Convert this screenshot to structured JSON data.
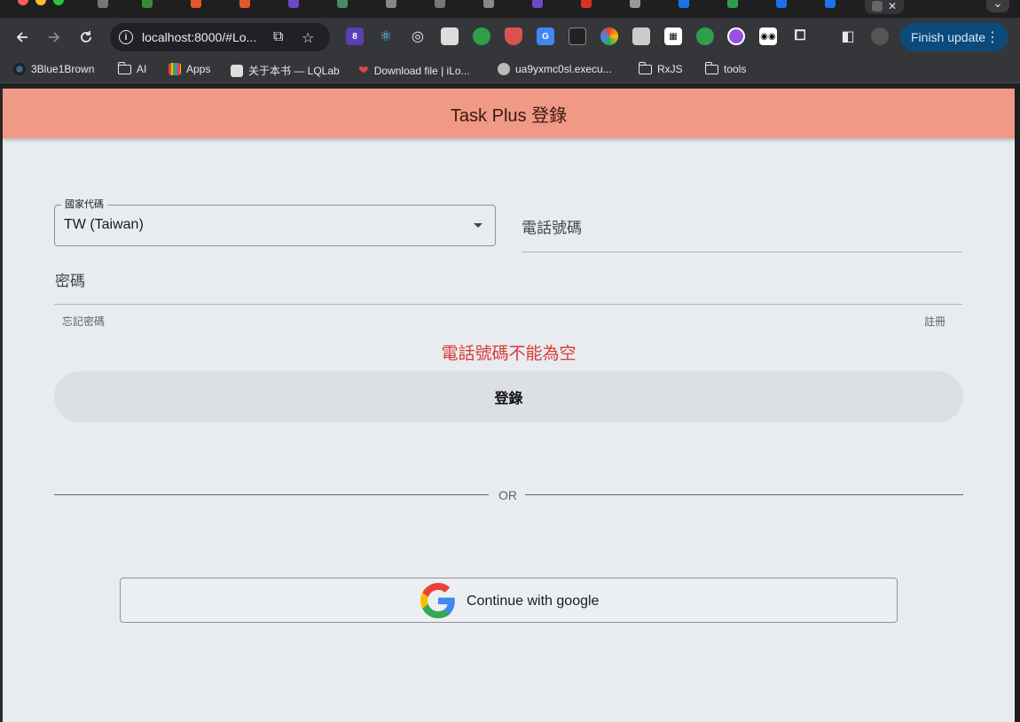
{
  "browser": {
    "address": "localhost:8000/#Lo...",
    "finish_update": "Finish update",
    "extension_badge": "8"
  },
  "bookmarks": [
    {
      "label": "3Blue1Brown",
      "icon": "3b1b-icon"
    },
    {
      "label": "AI",
      "icon": "folder-icon"
    },
    {
      "label": "Apps",
      "icon": "apps-grid-icon"
    },
    {
      "label": "关于本书 — LQLab",
      "icon": "book-icon"
    },
    {
      "label": "Download file | iLo...",
      "icon": "heart-icon"
    },
    {
      "label": "ua9yxmc0sl.execu...",
      "icon": "globe-icon"
    },
    {
      "label": "RxJS",
      "icon": "folder-icon"
    },
    {
      "label": "tools",
      "icon": "folder-icon"
    }
  ],
  "app": {
    "title": "Task Plus 登錄"
  },
  "form": {
    "country_label": "國家代碼",
    "country_value": "TW (Taiwan)",
    "phone_label": "電話號碼",
    "password_label": "密碼",
    "forgot_link": "忘記密碼",
    "register_link": "註冊",
    "error_message": "電話號碼不能為空",
    "login_button": "登錄",
    "or_divider": "OR",
    "google_button": "Continue with google"
  },
  "colors": {
    "appbar": "#ef9986",
    "page_bg": "#e8ebef",
    "error": "#d93a36",
    "finish_update_bg": "#0b4a7a"
  }
}
